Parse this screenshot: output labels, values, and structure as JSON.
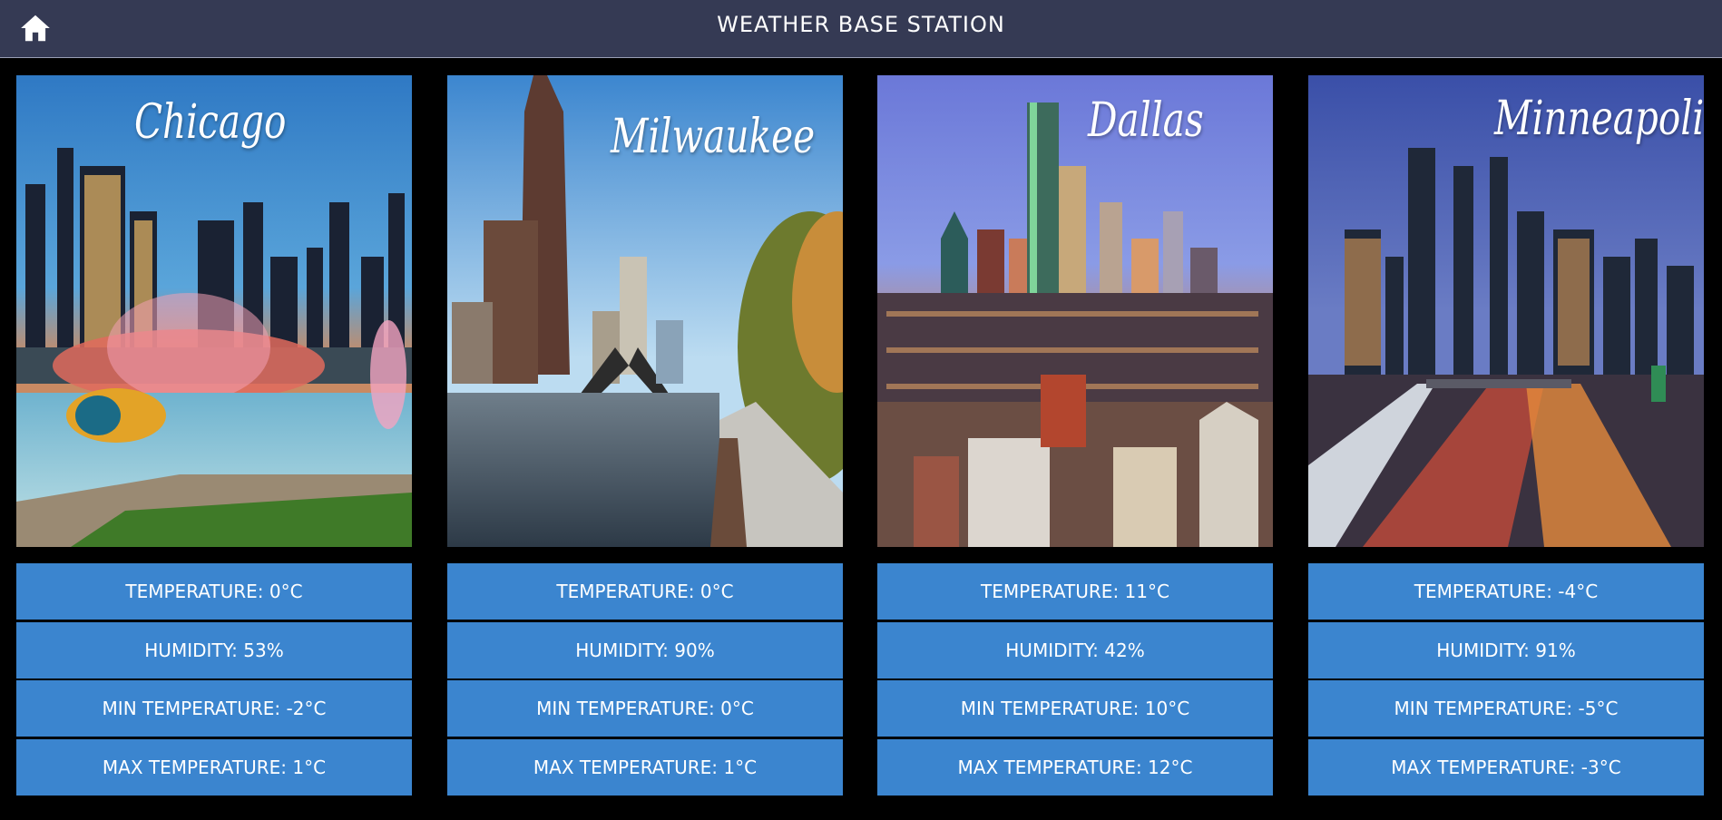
{
  "header": {
    "title": "WEATHER BASE STATION",
    "home_icon": "home-icon"
  },
  "cities": [
    {
      "name": "Chicago",
      "temperature": "TEMPERATURE: 0°C",
      "humidity": "HUMIDITY: 53%",
      "min_temperature": "MIN TEMPERATURE: -2°C",
      "max_temperature": "MAX TEMPERATURE: 1°C"
    },
    {
      "name": "Milwaukee",
      "temperature": "TEMPERATURE: 0°C",
      "humidity": "HUMIDITY: 90%",
      "min_temperature": "MIN TEMPERATURE: 0°C",
      "max_temperature": "MAX TEMPERATURE: 1°C"
    },
    {
      "name": "Dallas",
      "temperature": "TEMPERATURE: 11°C",
      "humidity": "HUMIDITY: 42%",
      "min_temperature": "MIN TEMPERATURE: 10°C",
      "max_temperature": "MAX TEMPERATURE: 12°C"
    },
    {
      "name": "Minneapolis",
      "temperature": "TEMPERATURE: -4°C",
      "humidity": "HUMIDITY: 91%",
      "min_temperature": "MIN TEMPERATURE: -5°C",
      "max_temperature": "MAX TEMPERATURE: -3°C"
    }
  ],
  "colors": {
    "topbar": "#353a54",
    "stat_tile": "#3b85cf",
    "background": "#000000"
  }
}
